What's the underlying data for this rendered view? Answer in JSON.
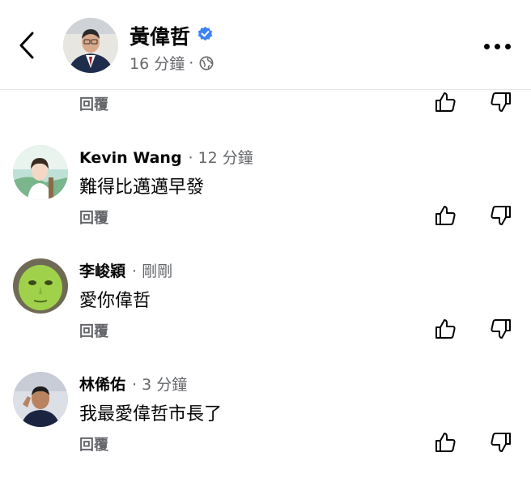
{
  "header": {
    "poster_name": "黃偉哲",
    "post_time": "16 分鐘",
    "dot": "·",
    "icons": {
      "back": "chevron-left-icon",
      "verified": "verified-badge-icon",
      "audience": "globe-icon",
      "more": "more-horizontal-icon"
    },
    "verified_color": "#3b82f6"
  },
  "top_partial": {
    "reply_label": "回覆"
  },
  "comments": [
    {
      "name": "Kevin Wang",
      "time": "12 分鐘",
      "text": "難得比邁邁早發",
      "reply_label": "回覆"
    },
    {
      "name": "李峻穎",
      "time": "剛剛",
      "text": "愛你偉哲",
      "reply_label": "回覆"
    },
    {
      "name": "林俙佑",
      "time": "3 分鐘",
      "text": "我最愛偉哲市長了",
      "reply_label": "回覆"
    }
  ],
  "colors": {
    "text": "#050505",
    "secondary": "#65676b",
    "divider": "#e4e6eb"
  }
}
